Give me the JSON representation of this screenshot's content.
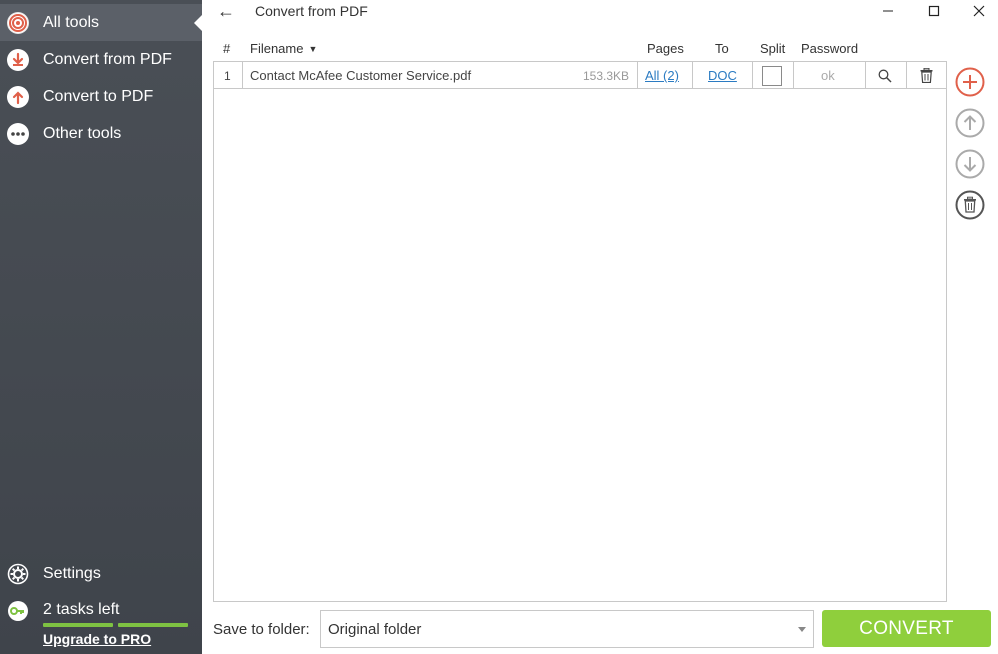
{
  "sidebar": {
    "items": [
      {
        "label": "All tools",
        "icon": "all-tools-icon",
        "active": true
      },
      {
        "label": "Convert from PDF",
        "icon": "convert-from-pdf-icon"
      },
      {
        "label": "Convert to PDF",
        "icon": "convert-to-pdf-icon"
      },
      {
        "label": "Other tools",
        "icon": "other-tools-icon"
      }
    ],
    "settings_label": "Settings",
    "tasks_label": "2 tasks left",
    "upgrade_label": "Upgrade to PRO"
  },
  "titlebar": {
    "title": "Convert from PDF",
    "back_icon": "←"
  },
  "table": {
    "headers": {
      "num": "#",
      "filename": "Filename",
      "pages": "Pages",
      "to": "To",
      "split": "Split",
      "password": "Password"
    },
    "rows": [
      {
        "num": "1",
        "filename": "Contact McAfee Customer Service.pdf",
        "size": "153.3KB",
        "pages": "All (2)",
        "to": "DOC",
        "split_checked": false,
        "password": "ok"
      }
    ]
  },
  "bottom": {
    "save_label": "Save to folder:",
    "folder_value": "Original folder",
    "convert_label": "CONVERT"
  },
  "colors": {
    "sidebar_bg": "#454a51",
    "accent_green": "#8fcf3c",
    "add_red": "#e0604a",
    "link_blue": "#2b7bc2"
  }
}
